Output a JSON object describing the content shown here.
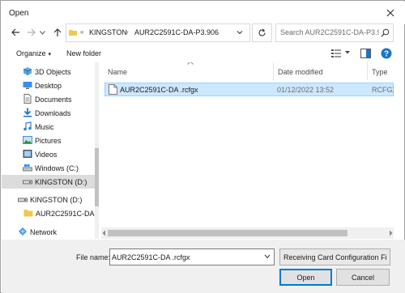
{
  "window": {
    "title": "Open"
  },
  "nav": {
    "address_segments": [
      "KINGSTON",
      "AUR2C2591C-DA-P3.906"
    ],
    "address_overflow": "«",
    "search_placeholder": "Search AUR2C2591C-DA-P3.9..."
  },
  "toolbar": {
    "organize_label": "Organize",
    "new_folder_label": "New folder"
  },
  "sidebar": {
    "items": [
      {
        "label": "3D Objects",
        "icon": "3d-objects-icon"
      },
      {
        "label": "Desktop",
        "icon": "desktop-icon"
      },
      {
        "label": "Documents",
        "icon": "documents-icon"
      },
      {
        "label": "Downloads",
        "icon": "downloads-icon"
      },
      {
        "label": "Music",
        "icon": "music-icon"
      },
      {
        "label": "Pictures",
        "icon": "pictures-icon"
      },
      {
        "label": "Videos",
        "icon": "videos-icon"
      },
      {
        "label": "Windows (C:)",
        "icon": "drive-icon"
      },
      {
        "label": "KINGSTON (D:)",
        "icon": "usb-drive-icon",
        "selected": true
      },
      {
        "label": "KINGSTON (D:)",
        "icon": "usb-drive-icon"
      },
      {
        "label": "AUR2C2591C-DA",
        "icon": "folder-icon"
      },
      {
        "label": "Network",
        "icon": "network-icon"
      }
    ]
  },
  "filelist": {
    "columns": [
      "Name",
      "Date modified",
      "Type"
    ],
    "files": [
      {
        "name": "AUR2C2591C-DA .rcfgx",
        "date_modified": "01/12/2022 13:52",
        "type": "RCFGX File",
        "selected": true
      }
    ]
  },
  "bottom": {
    "file_name_label": "File name:",
    "file_name_value": "AUR2C2591C-DA .rcfgx",
    "file_type_value": "Receiving Card Configuration Fi",
    "open_label": "Open",
    "cancel_label": "Cancel"
  },
  "colors": {
    "selection_bg": "#cce8ff",
    "selection_border": "#99d1ff",
    "nav_selected_bg": "#dcdcdc",
    "accent": "#0078d7"
  }
}
